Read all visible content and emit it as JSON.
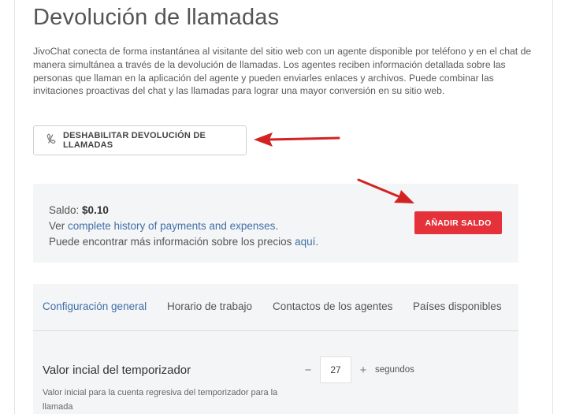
{
  "page": {
    "title": "Devolución de llamadas",
    "description": "JivoChat conecta de forma instantánea al visitante del sitio web con un agente disponible por teléfono y en el chat de manera simultánea a través de la devolución de llamadas. Los agentes reciben información detallada sobre las personas que llaman en la aplicación del agente y pueden enviarles enlaces y archivos. Puede combinar las invitaciones proactivas del chat y las llamadas para lograr una mayor conversión en su sitio web."
  },
  "disable_button": {
    "label": "DESHABILITAR DEVOLUCIÓN DE LLAMADAS",
    "icon": "phone-icon"
  },
  "balance": {
    "label": "Saldo:",
    "amount": "$0.10",
    "history_prefix": "Ver ",
    "history_link": "complete history of payments and expenses",
    "history_suffix": ".",
    "prices_prefix": "Puede encontrar más información sobre los precios ",
    "prices_link": "aquí",
    "prices_suffix": ".",
    "add_button": "AÑADIR SALDO"
  },
  "tabs": [
    {
      "label": "Configuración general",
      "active": true
    },
    {
      "label": "Horario de trabajo",
      "active": false
    },
    {
      "label": "Contactos de los agentes",
      "active": false
    },
    {
      "label": "Países disponibles",
      "active": false
    }
  ],
  "timer": {
    "label": "Valor incial del temporizador",
    "help": "Valor inicial para la cuenta regresiva del temporizador para la llamada",
    "minus": "−",
    "value": "27",
    "plus": "+",
    "unit": "segundos"
  },
  "colors": {
    "accent_red": "#e5323a",
    "link_blue": "#3f6fa8",
    "annotation_arrow": "#d42222",
    "panel_bg": "#f4f5f6"
  }
}
